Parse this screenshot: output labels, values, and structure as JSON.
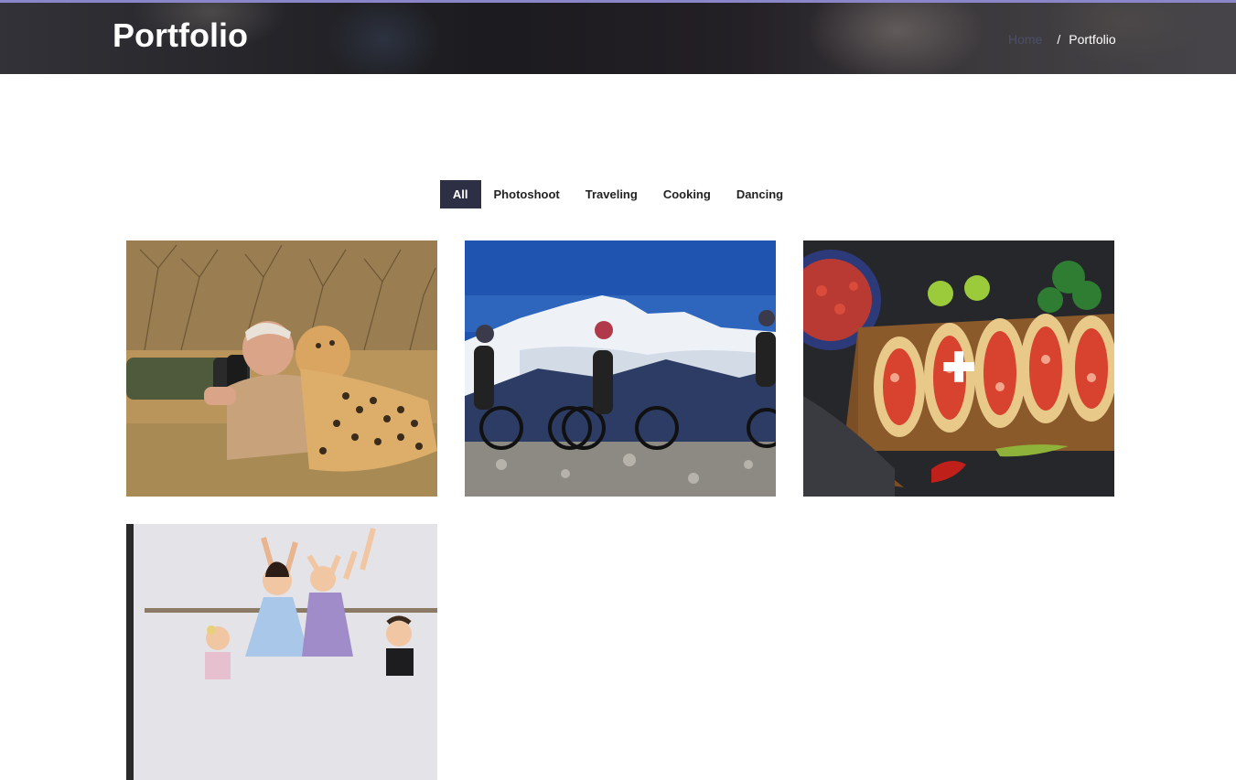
{
  "header": {
    "title": "Portfolio",
    "breadcrumb": {
      "home": "Home",
      "separator": "/",
      "current": "Portfolio"
    }
  },
  "filters": [
    "All",
    "Photoshoot",
    "Traveling",
    "Cooking",
    "Dancing"
  ],
  "active_filter": "All",
  "portfolio": {
    "items": [
      {
        "category": "Photoshoot",
        "subject": "photographer with cheetah"
      },
      {
        "category": "Traveling",
        "subject": "mountain bikers"
      },
      {
        "category": "Cooking",
        "subject": "tacos on board",
        "overlay_icon": "plus-icon"
      },
      {
        "category": "Dancing",
        "subject": "young ballet dancers"
      }
    ]
  },
  "colors": {
    "accent": "#2d3044",
    "topline": "#8b86c9"
  }
}
